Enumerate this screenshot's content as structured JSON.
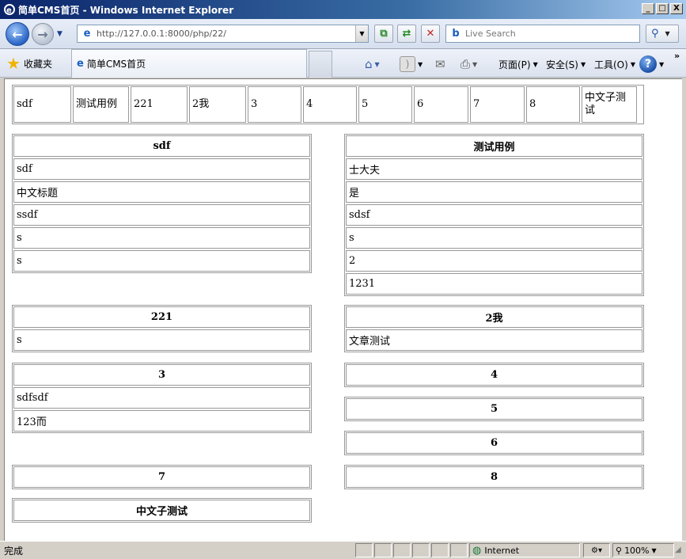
{
  "window": {
    "title": "简单CMS首页 - Windows Internet Explorer",
    "controls": {
      "minimize": "_",
      "maximize": "□",
      "close": "X"
    }
  },
  "navbar": {
    "url": "http://127.0.0.1:8000/php/22/",
    "search_placeholder": "Live Search"
  },
  "favbar": {
    "favorites_label": "收藏夹",
    "tab_title": "简单CMS首页",
    "page_menu": "页面(P)",
    "safety_menu": "安全(S)",
    "tools_menu": "工具(O)"
  },
  "page": {
    "nav_items": [
      "sdf",
      "测试用例",
      "221",
      "2我",
      "3",
      "4",
      "5",
      "6",
      "7",
      "8",
      "中文子测试"
    ],
    "sections": {
      "sdf": {
        "title": "sdf",
        "items": [
          "sdf",
          "中文标题",
          "ssdf",
          "s",
          "s"
        ]
      },
      "test": {
        "title": "测试用例",
        "items": [
          "士大夫",
          "是",
          "sdsf",
          "s",
          "2",
          "1231"
        ]
      },
      "s221": {
        "title": "221",
        "items": [
          "s"
        ]
      },
      "s2wo": {
        "title": "2我",
        "items": [
          "文章测试"
        ]
      },
      "s3": {
        "title": "3",
        "items": [
          "sdfsdf",
          "123而"
        ]
      },
      "s4": {
        "title": "4"
      },
      "s5": {
        "title": "5"
      },
      "s6": {
        "title": "6"
      },
      "s7": {
        "title": "7"
      },
      "s8": {
        "title": "8"
      },
      "szh": {
        "title": "中文子测试"
      }
    }
  },
  "statusbar": {
    "status": "完成",
    "zone": "Internet",
    "zoom": "100%"
  }
}
